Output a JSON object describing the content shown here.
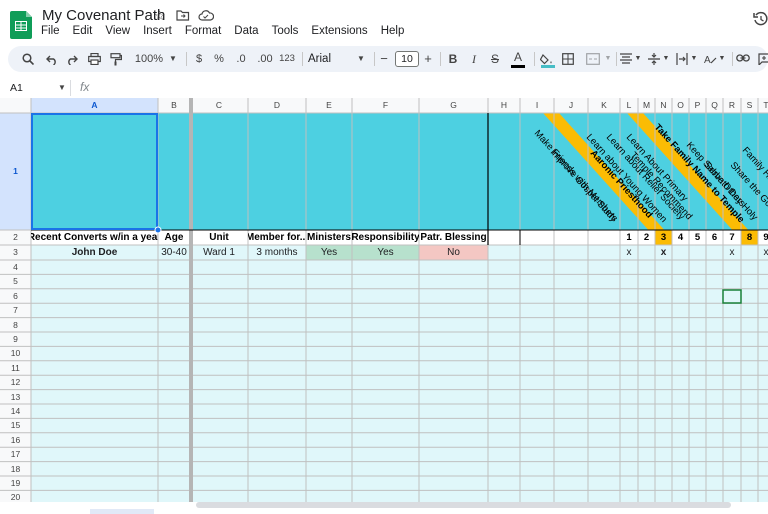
{
  "app": {
    "title": "My Covenant Path",
    "menu": [
      "File",
      "Edit",
      "View",
      "Insert",
      "Format",
      "Data",
      "Tools",
      "Extensions",
      "Help"
    ],
    "brand_color": "#0f9d58"
  },
  "toolbar": {
    "zoom": "100%",
    "currency": "$",
    "percent": "%",
    "dec_decrease": ".0",
    "dec_increase": ".00",
    "number_format": "123",
    "font": "Arial",
    "font_size": "10",
    "minus": "−",
    "plus": "+",
    "bold": "B",
    "italic": "I",
    "strike": "S",
    "text_color_label": "A",
    "text_color": "#000000",
    "fill_color": "#46bdc6"
  },
  "formula_bar": {
    "cell_ref": "A1",
    "fx": "fx",
    "value": ""
  },
  "sheet": {
    "columns": [
      "A",
      "B",
      "C",
      "D",
      "E",
      "F",
      "G",
      "H",
      "I",
      "J",
      "K",
      "L",
      "M",
      "N",
      "O",
      "P",
      "Q",
      "R",
      "S",
      "T"
    ],
    "rows": [
      "1",
      "2",
      "3",
      "4",
      "5",
      "6",
      "7",
      "8",
      "9",
      "10",
      "11",
      "12",
      "13",
      "14",
      "15",
      "16",
      "17",
      "18",
      "19",
      "20"
    ],
    "header_fill": "#4dd0e1",
    "body_fill": "#e0f7fa",
    "banner_color": "#fbbc04",
    "headers": [
      "Recent Converts w/in a year",
      "Age",
      "Unit",
      "Member for...",
      "Ministers",
      "Responsibility",
      "Patr. Blessing"
    ],
    "diagonal_labels": [
      "Make Friends with Members",
      "Improve Gospel Study",
      "Aaronic Priesthood",
      "Learn about Young Women",
      "Learn about Relief Society",
      "Learn About Primary",
      "Temple Recommend",
      "Take Family Name to Temple",
      "Keep Sabbath Day Holy",
      "Serve Others",
      "Share the Gospel",
      "Family History"
    ],
    "step_numbers": [
      "1",
      "2",
      "3",
      "4",
      "5",
      "6",
      "7",
      "8",
      "9"
    ],
    "record": {
      "name": "John Doe",
      "age": "30-40",
      "unit": "Ward 1",
      "member_for": "3 months",
      "ministers": "Yes",
      "responsibility": "Yes",
      "patr_blessing": "No",
      "marks": {
        "L": "x",
        "N": "x",
        "R": "x",
        "T": "x"
      }
    },
    "yes_color": "#b7e1cd",
    "no_color": "#f4c7c3"
  }
}
